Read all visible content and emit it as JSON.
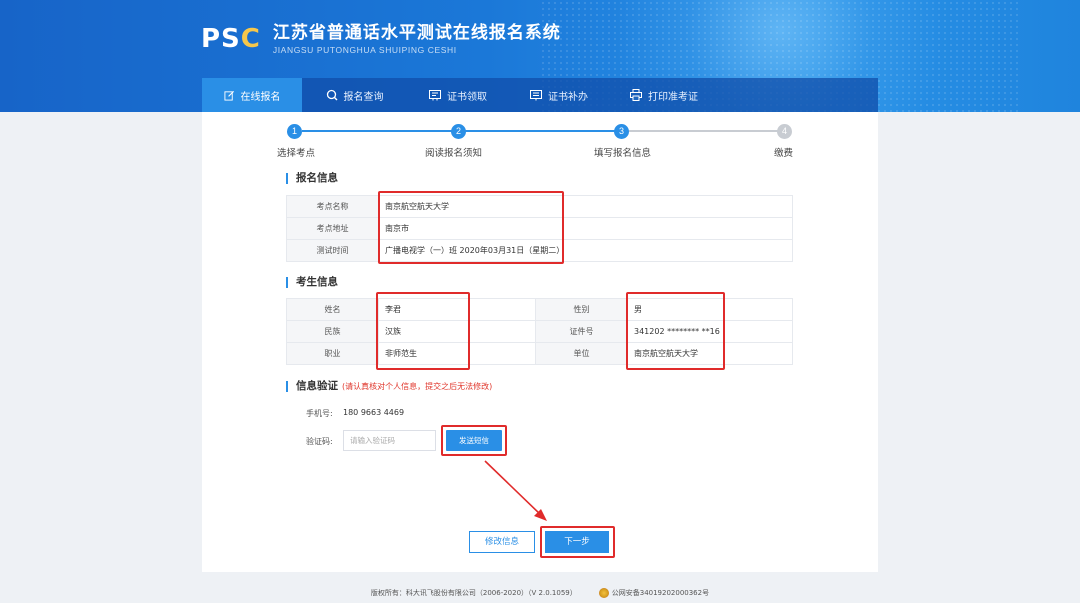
{
  "brand": {
    "logo_text_ps": "PS",
    "logo_text_c": "C",
    "title": "江苏省普通话水平测试在线报名系统",
    "subtitle": "JIANGSU PUTONGHUA SHUIPING CESHI"
  },
  "nav": {
    "items": [
      {
        "label": "在线报名",
        "icon": "edit-icon",
        "active": true
      },
      {
        "label": "报名查询",
        "icon": "search-icon",
        "active": false
      },
      {
        "label": "证书领取",
        "icon": "certificate-icon",
        "active": false
      },
      {
        "label": "证书补办",
        "icon": "certificate-reissue-icon",
        "active": false
      },
      {
        "label": "打印准考证",
        "icon": "printer-icon",
        "active": false
      }
    ]
  },
  "steps": [
    {
      "num": "1",
      "label": "选择考点",
      "state": "done"
    },
    {
      "num": "2",
      "label": "阅读报名须知",
      "state": "done"
    },
    {
      "num": "3",
      "label": "填写报名信息",
      "state": "current"
    },
    {
      "num": "4",
      "label": "缴费",
      "state": "pending"
    }
  ],
  "registration": {
    "title": "报名信息",
    "rows": [
      {
        "label": "考点名称",
        "value": "南京航空航天大学"
      },
      {
        "label": "考点地址",
        "value": "南京市"
      },
      {
        "label": "测试时间",
        "value": "广播电视学（一）班 2020年03月31日（星期二）"
      }
    ]
  },
  "candidate": {
    "title": "考生信息",
    "rows": [
      {
        "l1": "姓名",
        "v1": "李君",
        "l2": "性别",
        "v2": "男"
      },
      {
        "l1": "民族",
        "v1": "汉族",
        "l2": "证件号",
        "v2": "341202 ******** **16"
      },
      {
        "l1": "职业",
        "v1": "非师范生",
        "l2": "单位",
        "v2": "南京航空航天大学"
      }
    ]
  },
  "verify": {
    "title": "信息验证",
    "note": "(请认真核对个人信息，提交之后无法修改)",
    "phone_label": "手机号:",
    "phone_value": "180 9663 4469",
    "code_label": "验证码:",
    "code_placeholder": "请输入验证码",
    "send_label": "发送短信"
  },
  "actions": {
    "edit_label": "修改信息",
    "next_label": "下一步"
  },
  "footer": {
    "copyright": "版权所有：科大讯飞股份有限公司（2006-2020）（V 2.0.1059）",
    "police": "公网安备34019202000362号"
  },
  "colors": {
    "accent": "#2a8fe6",
    "highlight_red": "#e02b2b",
    "step_pending": "#c8ccd2"
  }
}
